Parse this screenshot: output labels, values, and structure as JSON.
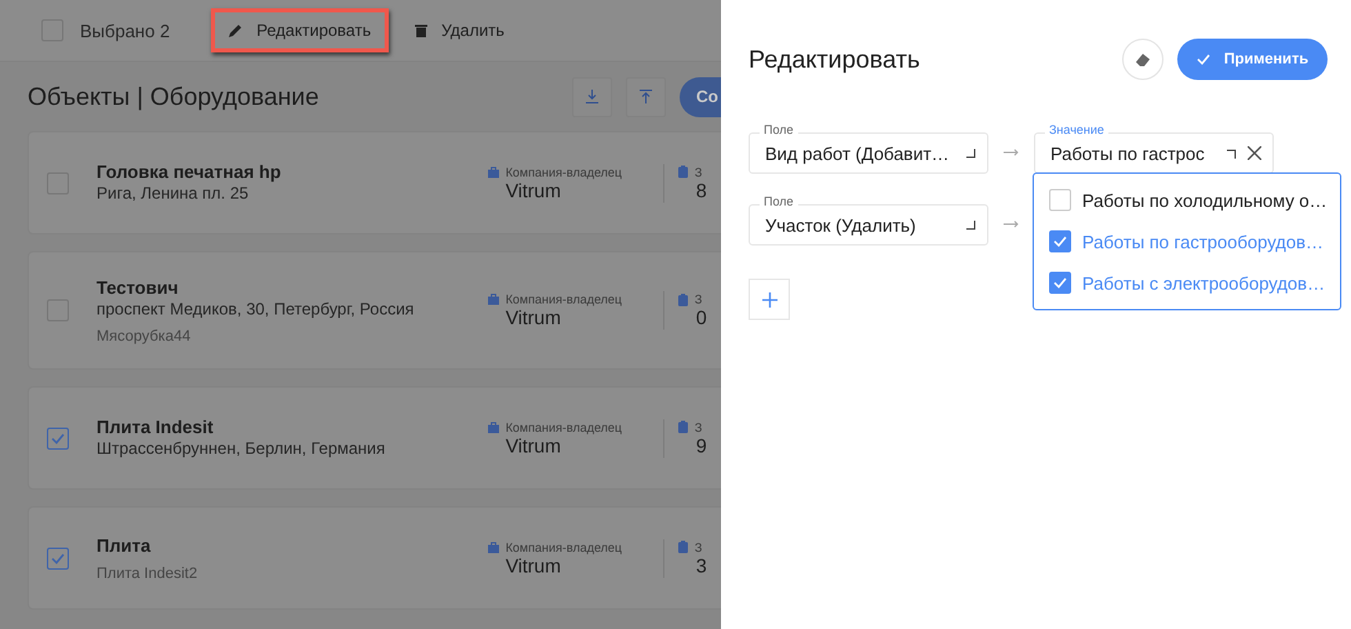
{
  "toolbar": {
    "select_all": {
      "checked": false
    },
    "selected_count": "Выбрано 2",
    "actions": [
      {
        "kind": "edit",
        "label": "Редактировать",
        "highlighted": true
      },
      {
        "kind": "delete",
        "label": "Удалить",
        "highlighted": false
      }
    ]
  },
  "page_title": "Объекты | Оборудование",
  "header_buttons": [
    {
      "kind": "download"
    },
    {
      "kind": "upload"
    },
    {
      "kind": "primary",
      "label": "Со"
    }
  ],
  "objects": [
    {
      "name": "Головка печатная hp",
      "address": "Рига, Ленина пл. 25",
      "checked": false,
      "owner_label": "Компания-владелец",
      "owner": "Vitrum",
      "column_2_label": "З",
      "column_2_value": "8"
    },
    {
      "name": "Тестович",
      "address": "проспект Медиков, 30, Петербург, Россия",
      "note": "Мясорубка44",
      "checked": false,
      "owner_label": "Компания-владелец",
      "owner": "Vitrum",
      "column_2_label": "З",
      "column_2_value": "0"
    },
    {
      "name": "Плита Indesit",
      "address": "Штрассенбруннен, Берлин, Германия",
      "checked": true,
      "owner_label": "Компания-владелец",
      "owner": "Vitrum",
      "column_2_label": "З",
      "column_2_value": "9"
    },
    {
      "name": "Плита",
      "note": "Плита Indesit2",
      "checked": true,
      "owner_label": "Компания-владелец",
      "owner": "Vitrum",
      "column_2_label": "З",
      "column_2_value": "3"
    }
  ],
  "panel": {
    "title": "Редактировать",
    "apply_label": "Применить",
    "rules": [
      {
        "field_label": "Поле",
        "field": "Вид работ (Добавит…",
        "value_label": "Значение",
        "value": "Работы по гастрос",
        "value_open": true
      },
      {
        "field_label": "Поле",
        "field": "Участок (Удалить)"
      }
    ],
    "dropdown": [
      {
        "label": "Работы по холодильному о…",
        "checked": false
      },
      {
        "label": "Работы по гастрооборудов…",
        "checked": true
      },
      {
        "label": "Работы с электрооборудов…",
        "checked": true
      }
    ]
  }
}
